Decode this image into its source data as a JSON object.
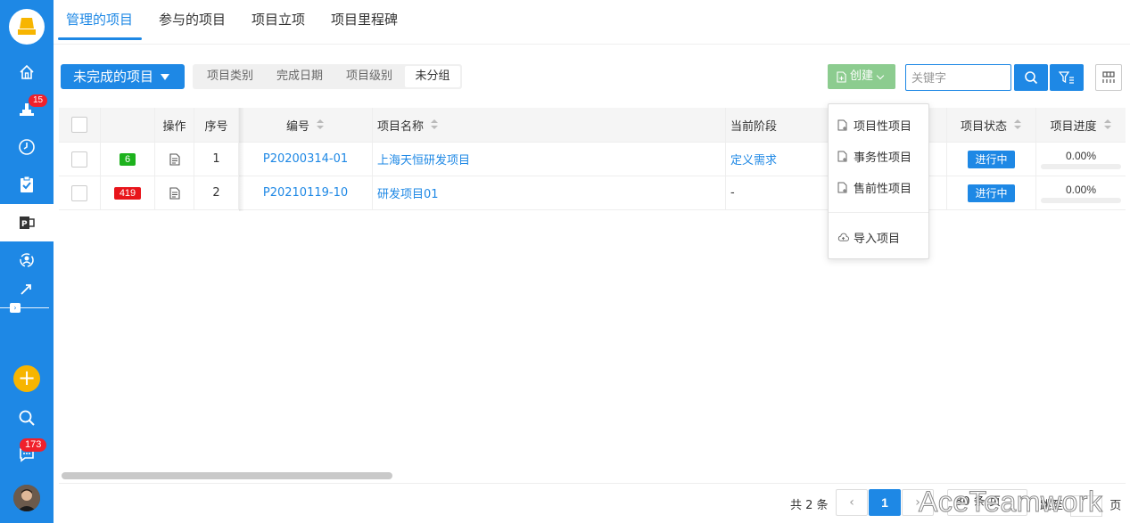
{
  "sidebar": {
    "badges": {
      "notifications": "15",
      "messages": "173"
    }
  },
  "tabs": [
    {
      "label": "管理的项目"
    },
    {
      "label": "参与的项目"
    },
    {
      "label": "项目立项"
    },
    {
      "label": "项目里程碑"
    }
  ],
  "toolbar": {
    "filter_dropdown": "未完成的项目",
    "group_by": [
      "项目类别",
      "完成日期",
      "项目级别",
      "未分组"
    ],
    "group_by_selected": "未分组",
    "create_label": "创建",
    "search_placeholder": "关键字"
  },
  "create_menu": {
    "items": [
      "项目性项目",
      "事务性项目",
      "售前性项目"
    ],
    "import_label": "导入项目"
  },
  "table": {
    "columns": {
      "action": "操作",
      "index": "序号",
      "code": "编号",
      "name": "项目名称",
      "phase": "当前阶段",
      "status": "项目状态",
      "progress": "项目进度"
    },
    "rows": [
      {
        "count": "6",
        "count_color": "#1db21d",
        "index": "1",
        "code": "P20200314-01",
        "name": "上海天恒研发项目",
        "phase": "定义需求",
        "status": "进行中",
        "progress_text": "0.00%",
        "progress": 0
      },
      {
        "count": "419",
        "count_color": "#e8151b",
        "index": "2",
        "code": "P20210119-10",
        "name": "研发项目01",
        "phase": "-",
        "status": "进行中",
        "progress_text": "0.00%",
        "progress": 0
      }
    ]
  },
  "pager": {
    "total": "共 2 条",
    "current_page": "1",
    "page_size": "80 条/页",
    "jump": "跳至",
    "page_unit": "页"
  },
  "watermark": "AceTeamwork",
  "colors": {
    "primary": "#1e88e5",
    "create_green": "#8ccc8f",
    "badge_red": "#f0212b",
    "plus_yellow": "#f7b500"
  }
}
